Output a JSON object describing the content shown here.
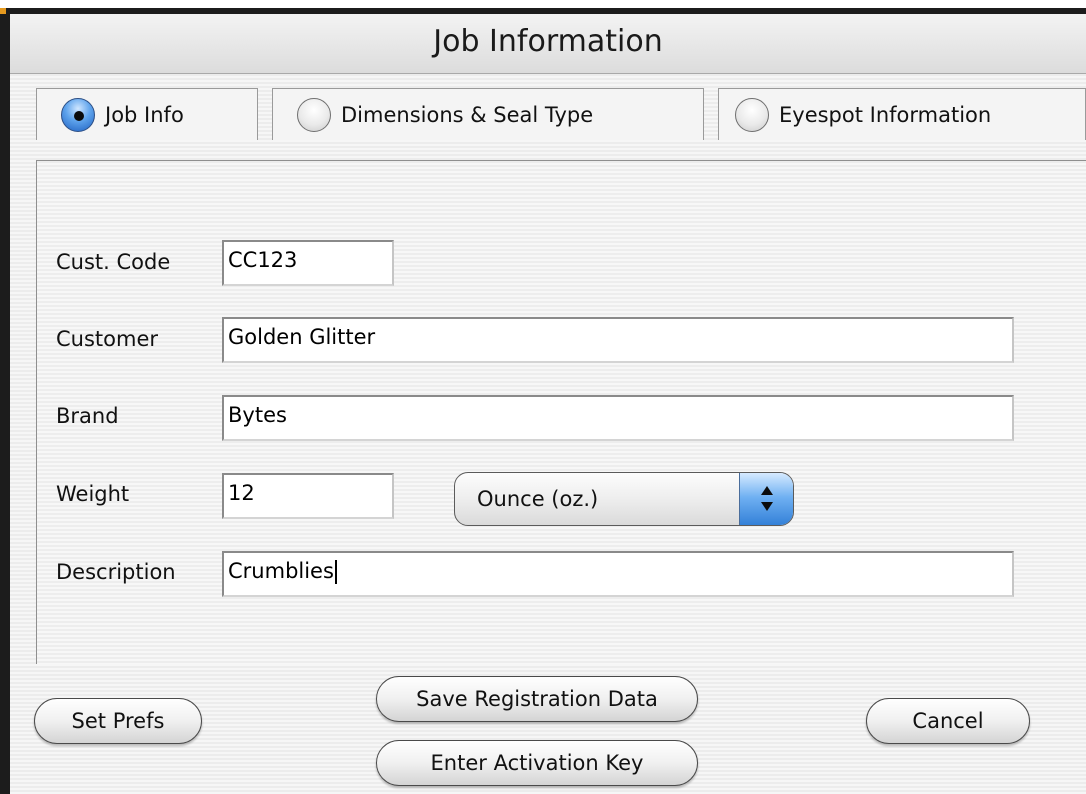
{
  "window": {
    "title": "Job Information"
  },
  "tabs": [
    {
      "label": "Job Info",
      "selected": true
    },
    {
      "label": "Dimensions & Seal Type",
      "selected": false
    },
    {
      "label": "Eyespot Information",
      "selected": false
    }
  ],
  "form": {
    "cust_code": {
      "label": "Cust. Code",
      "value": "CC123"
    },
    "customer": {
      "label": "Customer",
      "value": "Golden Glitter"
    },
    "brand": {
      "label": "Brand",
      "value": "Bytes"
    },
    "weight": {
      "label": "Weight",
      "value": "12",
      "unit": "Ounce (oz.)"
    },
    "description": {
      "label": "Description",
      "value": "Crumblies"
    }
  },
  "buttons": {
    "set_prefs": "Set Prefs",
    "save_registration": "Save Registration Data",
    "enter_activation": "Enter Activation Key",
    "cancel": "Cancel"
  },
  "colors": {
    "accent": "#3a86dd",
    "window_bg": "#ececec"
  }
}
